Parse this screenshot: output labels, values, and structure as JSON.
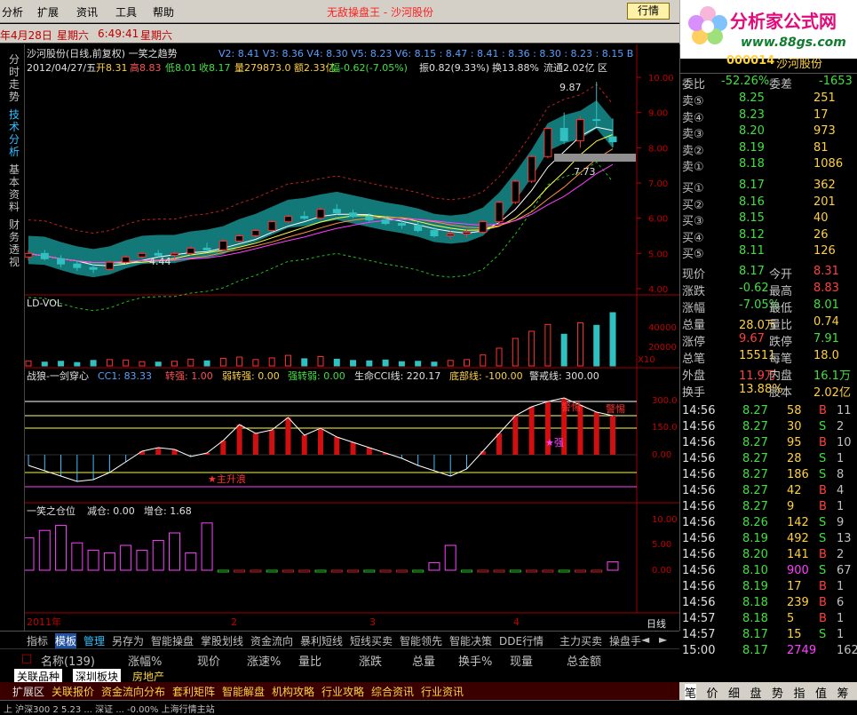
{
  "menu": {
    "items": [
      "分析",
      "扩展",
      "资讯",
      "工具",
      "帮助"
    ],
    "title_red": "无敌操盘王 - 沙河股份",
    "mode_button": "行情"
  },
  "logo": {
    "title": "分析家公式网",
    "url": "www.88gs.com"
  },
  "datebar": {
    "date": "年4月28日",
    "weekday": "星期六",
    "time": "6:49:41",
    "weekday2": "星期六"
  },
  "left_tabs": [
    "分时走势",
    "技术分析",
    "基本资料",
    "财务透视"
  ],
  "main_chart": {
    "header1": "沙河股份(日线,前复权) 一笑之趋势",
    "header1_vals": "V2: 8.41  V3: 8.36  V4: 8.30  V5: 8.23  V6: 8.15  : 8.47  : 8.41  : 8.36  : 8.30  : 8.23  : 8.15  B",
    "header2_date": "2012/04/27/五",
    "header2_open": "开8.31",
    "header2_high": "高8.83",
    "header2_low": "低8.01",
    "header2_close": "收8.17",
    "header2_vol": "量279873.0",
    "header2_amt": "额2.33亿",
    "header2_chg": "幅-0.62(-7.05%)",
    "header2_amp": "振0.82(9.33%)",
    "header2_turn": "换13.88%",
    "header2_float": "流通2.02亿",
    "header2_zone": "区",
    "high_label": "9.87",
    "low_label": "4.44",
    "mid_label": "7.73",
    "yaxis": [
      "10.00",
      "9.00",
      "8.00",
      "7.00",
      "6.00",
      "5.00",
      "4.00"
    ]
  },
  "vol_panel": {
    "title": "LD-VOL",
    "yaxis": [
      "40000",
      "20000"
    ],
    "unit": "X10"
  },
  "cci_panel": {
    "title": "战狼-一剑穿心",
    "cc1": "CC1: 83.33",
    "zq": "转强: 1.00",
    "rzq": "弱转强: 0.00",
    "qzr": "强转弱: 0.00",
    "life": "生命CCI线: 220.17",
    "bottom": "底部线: -100.00",
    "warn": "警戒线: 300.00",
    "yaxis": [
      "300.0",
      "150.0",
      "0.00"
    ],
    "label_zhu": "★主升",
    "label_zhusheng": "★主升浪",
    "label_warn1": "警惕",
    "label_warn2": "警惕",
    "label_star": "★强"
  },
  "pos_panel": {
    "title": "一笑之仓位",
    "reduce": "减仓: 0.00",
    "add": "增仓: 1.68",
    "yaxis": [
      "10.00",
      "5.00",
      "0.00"
    ]
  },
  "xaxis": {
    "labels": [
      "2011年",
      "2",
      "3",
      "4"
    ],
    "period": "日线"
  },
  "quote": {
    "code": "000014",
    "name": "沙河股份",
    "ratio_label": "委比",
    "ratio": "-52.26%",
    "diff_label": "委差",
    "diff": "-1653",
    "sells": [
      [
        "卖⑤",
        "8.25",
        "251"
      ],
      [
        "卖④",
        "8.23",
        "17"
      ],
      [
        "卖③",
        "8.20",
        "973"
      ],
      [
        "卖②",
        "8.19",
        "81"
      ],
      [
        "卖①",
        "8.18",
        "1086"
      ]
    ],
    "buys": [
      [
        "买①",
        "8.17",
        "362"
      ],
      [
        "买②",
        "8.16",
        "201"
      ],
      [
        "买③",
        "8.15",
        "40"
      ],
      [
        "买④",
        "8.12",
        "26"
      ],
      [
        "买⑤",
        "8.11",
        "126"
      ]
    ],
    "stats": [
      [
        "现价",
        "8.17",
        "今开",
        "8.31"
      ],
      [
        "涨跌",
        "-0.62",
        "最高",
        "8.83"
      ],
      [
        "涨幅",
        "-7.05%",
        "最低",
        "8.01"
      ],
      [
        "总量",
        "28.0万",
        "量比",
        "0.74"
      ],
      [
        "涨停",
        "9.67",
        "跌停",
        "7.91"
      ],
      [
        "总笔",
        "15511",
        "每笔",
        "18.0"
      ],
      [
        "外盘",
        "11.9万",
        "内盘",
        "16.1万"
      ],
      [
        "换手",
        "13.88%",
        "股本",
        "2.02亿"
      ]
    ],
    "ticks": [
      [
        "14:56",
        "8.27",
        "58",
        "B",
        "11"
      ],
      [
        "14:56",
        "8.27",
        "30",
        "S",
        "2"
      ],
      [
        "14:56",
        "8.27",
        "95",
        "B",
        "10"
      ],
      [
        "14:56",
        "8.27",
        "28",
        "S",
        "1"
      ],
      [
        "14:56",
        "8.27",
        "186",
        "S",
        "8"
      ],
      [
        "14:56",
        "8.27",
        "42",
        "B",
        "4"
      ],
      [
        "14:56",
        "8.27",
        "9",
        "B",
        "1"
      ],
      [
        "14:56",
        "8.26",
        "142",
        "S",
        "9"
      ],
      [
        "14:56",
        "8.19",
        "492",
        "S",
        "13"
      ],
      [
        "14:56",
        "8.20",
        "141",
        "B",
        "2"
      ],
      [
        "14:56",
        "8.10",
        "900",
        "S",
        "67"
      ],
      [
        "14:56",
        "8.19",
        "17",
        "B",
        "1"
      ],
      [
        "14:56",
        "8.18",
        "239",
        "B",
        "6"
      ],
      [
        "14:57",
        "8.18",
        "5",
        "B",
        "1"
      ],
      [
        "14:57",
        "8.17",
        "15",
        "S",
        "1"
      ],
      [
        "15:00",
        "8.17",
        "2749",
        "",
        "162"
      ]
    ]
  },
  "bottom_tabs": [
    "指标",
    "模板",
    "管理",
    "另存为",
    "智能操盘",
    "掌股划线",
    "资金流向",
    "暴利短线",
    "短线买卖",
    "智能领先",
    "智能决策",
    "DDE行情",
    "主力买卖",
    "操盘手"
  ],
  "list_header": {
    "name": "名称(139)",
    "chg": "涨幅%",
    "price": "现价",
    "speed": "涨速%",
    "volratio": "量比",
    "updown": "涨跌",
    "vol": "总量",
    "turn": "换手%",
    "cur": "现量",
    "amount": "总金额"
  },
  "sector_tabs": [
    "关联品种",
    "深圳板块",
    "房地产"
  ],
  "bottom_menu": [
    "扩展区",
    "关联报价",
    "资金流向分布",
    "套利矩阵",
    "智能解盘",
    "机构攻略",
    "行业攻略",
    "综合资讯",
    "行业资讯"
  ],
  "quote_tabs": [
    "笔",
    "价",
    "细",
    "盘",
    "势",
    "指",
    "值",
    "筹"
  ],
  "status": "上  沪深300   2   5.23   ...   深证 ...   -0.00%   上海行情主站",
  "chart_data": {
    "type": "candlestick",
    "ylim": [
      4.0,
      10.0
    ],
    "candles": [
      [
        4.9,
        5.1,
        4.8,
        5.0
      ],
      [
        5.0,
        5.1,
        4.8,
        4.85
      ],
      [
        4.85,
        4.95,
        4.6,
        4.7
      ],
      [
        4.7,
        4.8,
        4.5,
        4.6
      ],
      [
        4.6,
        4.7,
        4.44,
        4.55
      ],
      [
        4.55,
        4.8,
        4.5,
        4.75
      ],
      [
        4.75,
        4.95,
        4.7,
        4.9
      ],
      [
        4.9,
        5.05,
        4.85,
        5.0
      ],
      [
        5.0,
        5.1,
        4.9,
        4.95
      ],
      [
        4.95,
        5.05,
        4.85,
        5.0
      ],
      [
        5.0,
        5.2,
        4.95,
        5.15
      ],
      [
        5.15,
        5.3,
        5.05,
        5.1
      ],
      [
        5.1,
        5.4,
        5.05,
        5.35
      ],
      [
        5.35,
        5.55,
        5.3,
        5.5
      ],
      [
        5.5,
        5.7,
        5.45,
        5.65
      ],
      [
        5.65,
        5.95,
        5.6,
        5.9
      ],
      [
        5.9,
        6.1,
        5.85,
        6.05
      ],
      [
        6.05,
        6.2,
        5.95,
        6.0
      ],
      [
        6.0,
        6.3,
        5.95,
        6.25
      ],
      [
        6.25,
        6.4,
        6.1,
        6.15
      ],
      [
        6.15,
        6.25,
        6.0,
        6.05
      ],
      [
        6.05,
        6.15,
        5.9,
        5.95
      ],
      [
        5.95,
        6.05,
        5.8,
        5.85
      ],
      [
        5.85,
        5.95,
        5.7,
        5.8
      ],
      [
        5.8,
        5.9,
        5.6,
        5.65
      ],
      [
        5.65,
        5.75,
        5.45,
        5.5
      ],
      [
        5.5,
        5.65,
        5.4,
        5.55
      ],
      [
        5.55,
        5.7,
        5.45,
        5.6
      ],
      [
        5.6,
        5.95,
        5.55,
        5.9
      ],
      [
        5.9,
        6.5,
        5.85,
        6.45
      ],
      [
        6.45,
        7.1,
        6.4,
        7.05
      ],
      [
        7.05,
        7.8,
        7.0,
        7.75
      ],
      [
        7.75,
        8.6,
        7.7,
        8.55
      ],
      [
        8.55,
        9.0,
        8.1,
        8.2
      ],
      [
        8.2,
        8.9,
        8.0,
        8.8
      ],
      [
        8.8,
        9.87,
        8.6,
        8.79
      ],
      [
        8.31,
        8.83,
        8.01,
        8.17
      ]
    ],
    "volumes": [
      1200,
      900,
      1100,
      800,
      1300,
      1500,
      1400,
      1000,
      900,
      1100,
      1600,
      1200,
      1800,
      2100,
      1500,
      1900,
      2500,
      1700,
      2200,
      1600,
      1300,
      1200,
      1400,
      1000,
      1100,
      900,
      1300,
      1500,
      2600,
      4200,
      6500,
      8200,
      9800,
      7500,
      10200,
      9600,
      12600
    ],
    "cci": [
      -60,
      -90,
      -120,
      -150,
      -140,
      -100,
      -40,
      20,
      40,
      30,
      -10,
      10,
      80,
      170,
      120,
      140,
      210,
      110,
      150,
      100,
      70,
      40,
      10,
      -20,
      -60,
      -90,
      -120,
      -80,
      20,
      120,
      220,
      270,
      300,
      320,
      280,
      240,
      220
    ],
    "position": [
      6.5,
      8.0,
      9.0,
      5.5,
      4.0,
      3.5,
      5.0,
      4.0,
      6.0,
      7.5,
      3.5,
      9.5,
      0,
      0,
      0,
      0,
      0,
      0,
      0,
      0,
      0,
      0,
      0,
      0,
      0,
      1.5,
      5.0,
      0,
      0,
      0,
      0,
      0,
      0,
      0,
      0,
      0,
      1.68
    ]
  }
}
